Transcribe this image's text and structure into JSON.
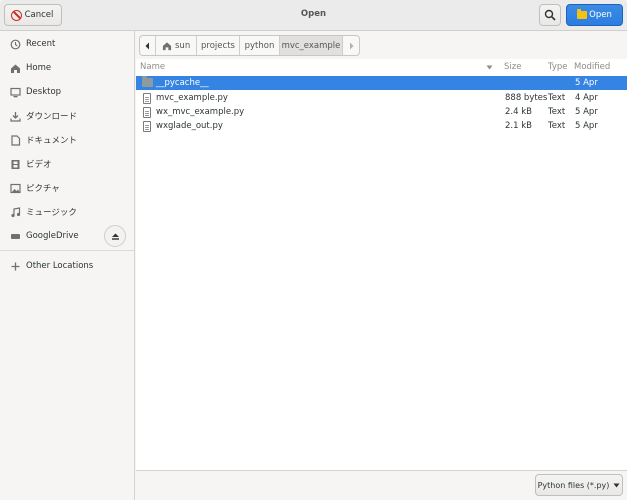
{
  "header": {
    "cancel_label": "Cancel",
    "title": "Open",
    "open_label": "Open",
    "accent_color": "#3584e4"
  },
  "sidebar": {
    "items": [
      {
        "label": "Recent",
        "icon": "clock-icon"
      },
      {
        "label": "Home",
        "icon": "home-icon"
      },
      {
        "label": "Desktop",
        "icon": "desktop-icon"
      },
      {
        "label": "ダウンロード",
        "icon": "download-icon"
      },
      {
        "label": "ドキュメント",
        "icon": "document-icon"
      },
      {
        "label": "ビデオ",
        "icon": "video-icon"
      },
      {
        "label": "ピクチャ",
        "icon": "picture-icon"
      },
      {
        "label": "ミュージック",
        "icon": "music-icon"
      },
      {
        "label": "GoogleDrive",
        "icon": "drive-icon"
      }
    ],
    "other_locations": "Other Locations"
  },
  "pathbar": {
    "segments": [
      "sun",
      "projects",
      "python",
      "mvc_example"
    ],
    "active": "mvc_example"
  },
  "files": {
    "columns": {
      "name": "Name",
      "size": "Size",
      "type": "Type",
      "modified": "Modified"
    },
    "rows": [
      {
        "name": "__pycache__",
        "size": "",
        "type": "",
        "modified": "5 Apr",
        "kind": "folder",
        "selected": true
      },
      {
        "name": "mvc_example.py",
        "size": "888 bytes",
        "type": "Text",
        "modified": "4 Apr",
        "kind": "file"
      },
      {
        "name": "wx_mvc_example.py",
        "size": "2.4 kB",
        "type": "Text",
        "modified": "5 Apr",
        "kind": "file"
      },
      {
        "name": "wxglade_out.py",
        "size": "2.1 kB",
        "type": "Text",
        "modified": "5 Apr",
        "kind": "file"
      }
    ]
  },
  "footer": {
    "filter_label": "Python files (*.py)"
  }
}
